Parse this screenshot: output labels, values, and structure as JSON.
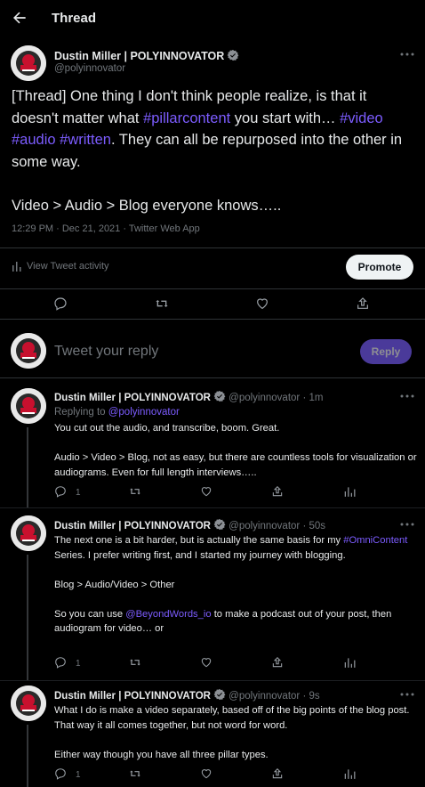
{
  "header": {
    "title": "Thread"
  },
  "main_tweet": {
    "author_name": "Dustin Miller | POLYINNOVATOR",
    "handle": "@polyinnovator",
    "text_parts": [
      {
        "t": "[Thread] One thing I don't think people realize, is that it doesn't matter what ",
        "c": "text"
      },
      {
        "t": "#pillarcontent",
        "c": "hashtag"
      },
      {
        "t": " you start with… ",
        "c": "text"
      },
      {
        "t": "#video",
        "c": "hashtag"
      },
      {
        "t": " ",
        "c": "text"
      },
      {
        "t": "#audio",
        "c": "hashtag"
      },
      {
        "t": " ",
        "c": "text"
      },
      {
        "t": "#written",
        "c": "hashtag"
      },
      {
        "t": ". They can all be repurposed into the other in some way.\n\nVideo > Audio > Blog everyone knows…..",
        "c": "text"
      }
    ],
    "meta": "12:29 PM · Dec 21, 2021 · Twitter Web App",
    "activity_label": "View Tweet activity",
    "promote_label": "Promote"
  },
  "reply_box": {
    "placeholder": "Tweet your reply",
    "button_label": "Reply"
  },
  "thread": [
    {
      "author_name": "Dustin Miller | POLYINNOVATOR",
      "handle_time": " @polyinnovator · 1m",
      "replying_prefix": "Replying to ",
      "replying_to": "@polyinnovator",
      "text_parts": [
        {
          "t": "You cut out the audio, and transcribe, boom. Great.\n\nAudio > Video > Blog, not as easy, but there are countless tools for visualization or audiograms. Even for full length interviews…..",
          "c": "text"
        }
      ],
      "reply_count": "1"
    },
    {
      "author_name": "Dustin Miller | POLYINNOVATOR",
      "handle_time": " @polyinnovator · 50s",
      "text_parts": [
        {
          "t": "The next one is a bit harder, but is actually the same basis for my ",
          "c": "text"
        },
        {
          "t": "#OmniContent",
          "c": "hashtag"
        },
        {
          "t": " Series. I prefer writing first, and I started my journey with blogging.\n\nBlog > Audio/Video > Other\n\nSo you can use ",
          "c": "text"
        },
        {
          "t": "@BeyondWords_io",
          "c": "hashtag"
        },
        {
          "t": " to make a podcast out of your post, then audiogram for video… or",
          "c": "text"
        }
      ],
      "reply_count": "1"
    },
    {
      "author_name": "Dustin Miller | POLYINNOVATOR",
      "handle_time": " @polyinnovator · 9s",
      "text_parts": [
        {
          "t": "What I do is make a video separately, based off of the big points of the blog post. That way it all comes together, but not word for word.\n\nEither way though you have all three pillar types.",
          "c": "text"
        }
      ],
      "reply_count": "1"
    }
  ],
  "icons": {
    "back": "arrow-left-icon",
    "verified": "verified-badge-icon",
    "more": "more-icon",
    "reply": "reply-icon",
    "retweet": "retweet-icon",
    "like": "heart-icon",
    "share": "share-icon",
    "analytics": "analytics-icon"
  },
  "colors": {
    "accent": "#7c5cff",
    "background": "#000000",
    "muted": "#71767b",
    "border": "#2f3336"
  }
}
